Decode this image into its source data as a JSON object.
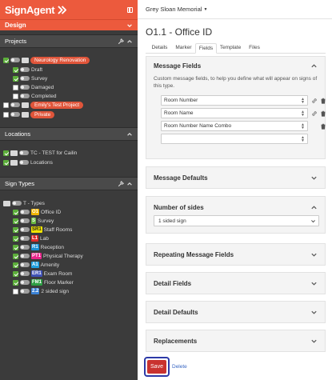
{
  "app": {
    "logo_text": "SignAgent"
  },
  "left_panel": {
    "section_label": "Design",
    "projects": {
      "title": "Projects",
      "items": [
        {
          "label": "Neurology Renovation",
          "pill": true,
          "checked": true
        },
        {
          "label": "Draft",
          "pill": false,
          "checked": true
        },
        {
          "label": "Survey",
          "pill": false,
          "checked": true
        },
        {
          "label": "Damaged",
          "pill": false,
          "checked": false
        },
        {
          "label": "Completed",
          "pill": false,
          "checked": false
        },
        {
          "label": "Emily's Test Project",
          "pill": true,
          "checked": false
        },
        {
          "label": "Private",
          "pill": true,
          "checked": false
        }
      ]
    },
    "locations": {
      "title": "Locations",
      "items": [
        {
          "label": "TC - TEST for Cailin"
        },
        {
          "label": "Locations"
        }
      ]
    },
    "sign_types": {
      "title": "Sign Types",
      "items": [
        {
          "code": "",
          "label": "T - Types",
          "code_bg": "",
          "code_fg": ""
        },
        {
          "code": "O1",
          "label": "Office ID",
          "code_bg": "#f2b705",
          "code_fg": "#fff"
        },
        {
          "code": "S",
          "label": "Survey",
          "code_bg": "#6bb843",
          "code_fg": "#fff"
        },
        {
          "code": "SR1",
          "label": "Staff Rooms",
          "code_bg": "#f2e400",
          "code_fg": "#222"
        },
        {
          "code": "L1",
          "label": "Lab",
          "code_bg": "#e02b2b",
          "code_fg": "#fff"
        },
        {
          "code": "R1",
          "label": "Reception",
          "code_bg": "#1a8fd1",
          "code_fg": "#fff"
        },
        {
          "code": "PT1",
          "label": "Physical Therapy",
          "code_bg": "#e8248a",
          "code_fg": "#fff"
        },
        {
          "code": "A1",
          "label": "Amenity",
          "code_bg": "#1fa0e0",
          "code_fg": "#fff"
        },
        {
          "code": "ER1",
          "label": "Exam Room",
          "code_bg": "#3f51b5",
          "code_fg": "#fff"
        },
        {
          "code": "FM1",
          "label": "Floor Marker",
          "code_bg": "#2e9e44",
          "code_fg": "#fff"
        },
        {
          "code": "2.2",
          "label": "2 sided sign",
          "code_bg": "#3b82d6",
          "code_fg": "#fff"
        }
      ]
    }
  },
  "main": {
    "org_switcher": "Grey Sloan Memorial",
    "title": "O1.1 - Office ID",
    "tabs": [
      "Details",
      "Marker",
      "Fields",
      "Template",
      "Files"
    ],
    "active_tab": "Fields",
    "message_fields": {
      "title": "Message Fields",
      "help": "Custom message fields, to help you define what will appear on signs of this type.",
      "fields": [
        "Room Number",
        "Room Name",
        "Room Number Name Combo",
        ""
      ]
    },
    "collapsed_sections": [
      "Message Defaults"
    ],
    "number_of_sides": {
      "title": "Number of sides",
      "value": "1 sided sign"
    },
    "more_sections": [
      "Repeating Message Fields",
      "Detail Fields",
      "Detail Defaults",
      "Replacements"
    ],
    "save_label": "Save",
    "delete_label": "Delete"
  },
  "colors": {
    "brand": "#ec5a3d",
    "sidebar": "#3b3b3b",
    "save": "#c9322f",
    "link": "#3a67c4"
  }
}
